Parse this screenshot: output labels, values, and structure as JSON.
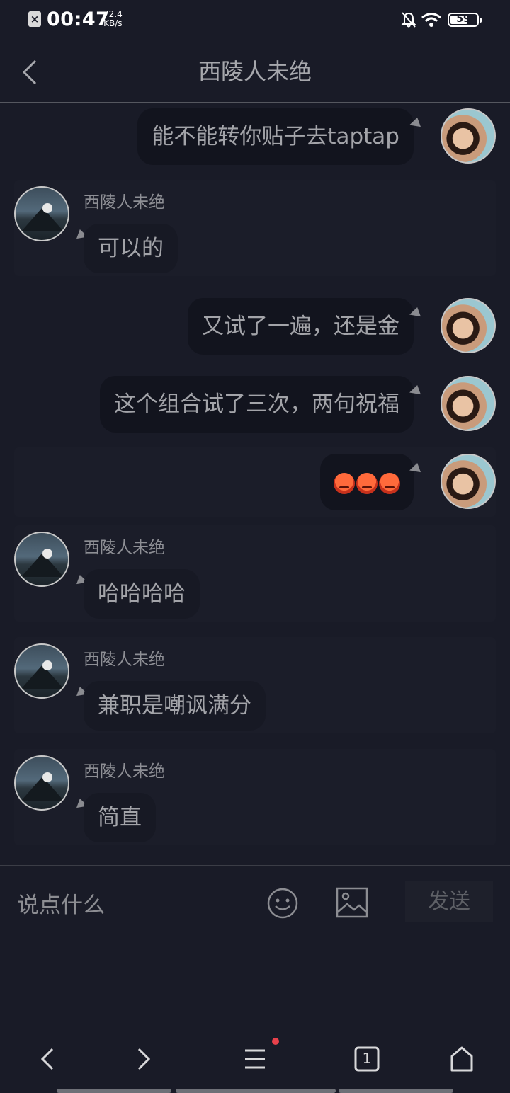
{
  "status_bar": {
    "time": "00:47",
    "speed_value": "72.4",
    "speed_unit": "KB/s",
    "battery": "59",
    "notification_icon": "x-notification-icon"
  },
  "header": {
    "title": "西陵人未绝",
    "back_icon": "back-arrow-icon"
  },
  "messages": [
    {
      "from": "self",
      "text": "能不能转你贴子去taptap"
    },
    {
      "from": "other",
      "sender": "西陵人未绝",
      "text": "可以的"
    },
    {
      "from": "self",
      "text": "又试了一遍，还是金"
    },
    {
      "from": "self",
      "text": "这个组合试了三次，两句祝福"
    },
    {
      "from": "self",
      "emoji": "angry-face-emoji",
      "count": 3
    },
    {
      "from": "other",
      "sender": "西陵人未绝",
      "text": "哈哈哈哈"
    },
    {
      "from": "other",
      "sender": "西陵人未绝",
      "text": "兼职是嘲讽满分"
    },
    {
      "from": "other",
      "sender": "西陵人未绝",
      "text": "简直"
    }
  ],
  "input": {
    "placeholder": "说点什么",
    "send_label": "发送"
  },
  "nav": {
    "tab_count": "1"
  },
  "colors": {
    "background": "#191b27",
    "bubble": "#12141e",
    "badge": "#e8414b"
  }
}
